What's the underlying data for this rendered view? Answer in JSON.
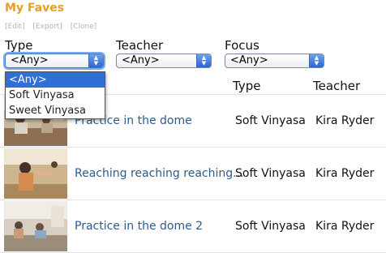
{
  "header": {
    "title": "My Faves"
  },
  "actions": [
    "[Edit]",
    "[Export]",
    "[Clone]"
  ],
  "filters": [
    {
      "label": "Type",
      "value": "<Any>"
    },
    {
      "label": "Teacher",
      "value": "<Any>"
    },
    {
      "label": "Focus",
      "value": "<Any>"
    }
  ],
  "dropdown": {
    "options": [
      "<Any>",
      "Soft Vinyasa",
      "Sweet Vinyasa"
    ],
    "selected": "<Any>"
  },
  "table": {
    "columns": [
      "Type",
      "Teacher"
    ],
    "rows": [
      {
        "title": "Practice in the dome",
        "type": "Soft Vinyasa",
        "teacher": "Kira Ryder"
      },
      {
        "title": "Reaching reaching reaching...",
        "type": "Soft Vinyasa",
        "teacher": "Kira Ryder"
      },
      {
        "title": "Practice in the dome 2",
        "type": "Soft Vinyasa",
        "teacher": "Kira Ryder"
      }
    ]
  },
  "colors": {
    "title": "#e6a01e",
    "link": "#2e5a8c",
    "highlight": "#2f6fd6"
  }
}
